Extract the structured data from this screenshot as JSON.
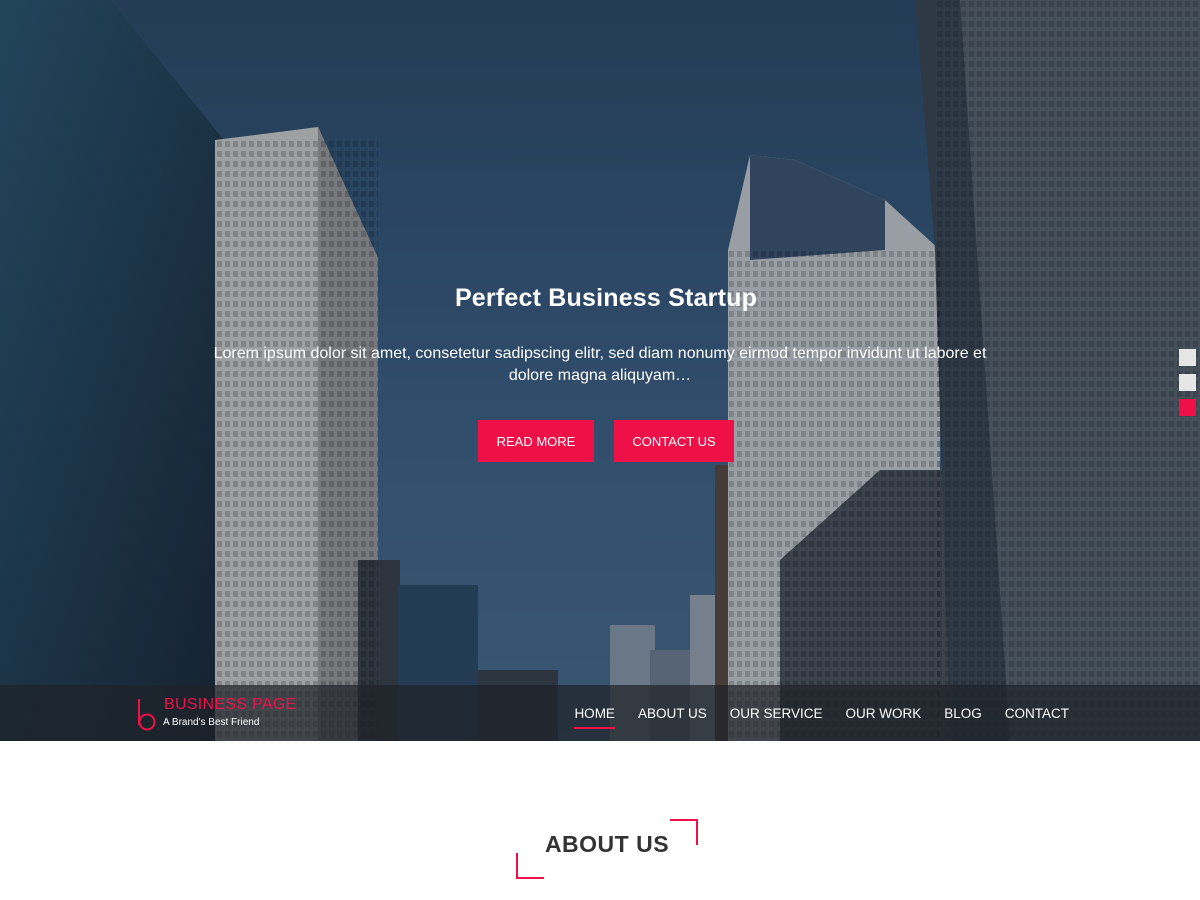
{
  "hero": {
    "title": "Perfect Business Startup",
    "text": "Lorem ipsum dolor sit amet, consetetur sadipscing elitr, sed diam nonumy eirmod tempor invidunt ut labore et dolore magna aliquyam…",
    "read_more_label": "READ MORE",
    "contact_label": "CONTACT US",
    "slides": {
      "count": 3,
      "active_index": 2
    }
  },
  "brand": {
    "title": "BUSINESS PAGE",
    "tagline": "A Brand's Best Friend",
    "accent_color": "#ef1048"
  },
  "nav": {
    "items": [
      {
        "label": "HOME",
        "active": true
      },
      {
        "label": "ABOUT US",
        "active": false
      },
      {
        "label": "OUR SERVICE",
        "active": false
      },
      {
        "label": "OUR WORK",
        "active": false
      },
      {
        "label": "BLOG",
        "active": false
      },
      {
        "label": "CONTACT",
        "active": false
      }
    ]
  },
  "about": {
    "title": "ABOUT US"
  }
}
